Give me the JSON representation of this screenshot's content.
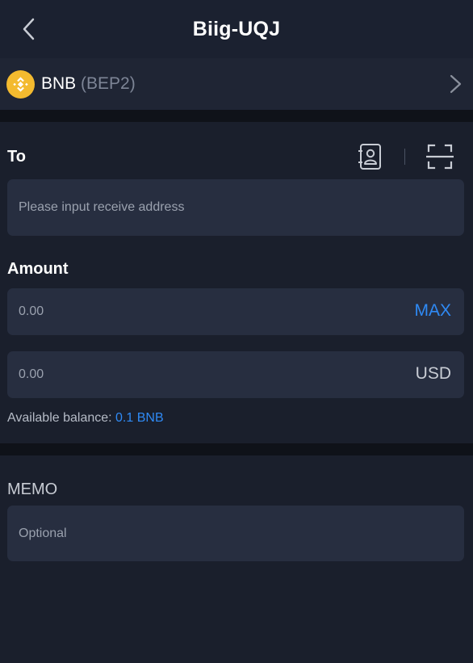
{
  "header": {
    "title": "Biig-UQJ",
    "back_icon": "chevron-left-icon"
  },
  "asset": {
    "symbol": "BNB",
    "network": "(BEP2)",
    "icon": "bnb-icon",
    "icon_color": "#f3ba2f"
  },
  "to_section": {
    "label": "To",
    "address_placeholder": "Please input receive address",
    "contacts_icon": "address-book-icon",
    "scan_icon": "scan-icon"
  },
  "amount_section": {
    "label": "Amount",
    "crypto_placeholder": "0.00",
    "max_label": "MAX",
    "usd_placeholder": "0.00",
    "usd_label": "USD",
    "balance_label": "Available balance: ",
    "balance_value": "0.1 BNB"
  },
  "memo_section": {
    "label": "MEMO",
    "placeholder": "Optional"
  },
  "colors": {
    "accent": "#2f8af5",
    "background": "#151a26",
    "input_bg": "#272e40"
  }
}
